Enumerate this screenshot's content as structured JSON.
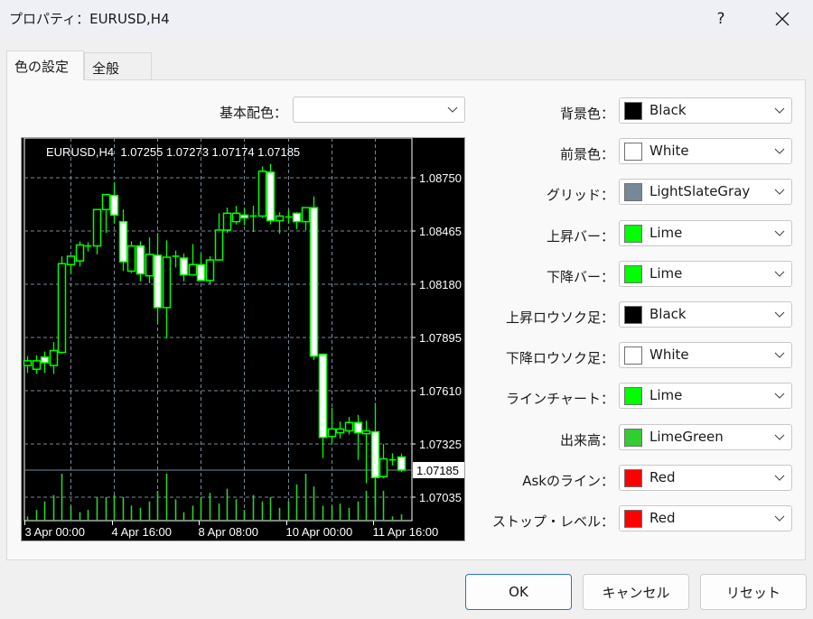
{
  "window": {
    "title": "プロパティ：EURUSD,H4",
    "help_label": "?",
    "close_label": "✕"
  },
  "tabs": [
    {
      "label": "色の設定",
      "active": true
    },
    {
      "label": "全般",
      "active": false
    }
  ],
  "base_scheme": {
    "label": "基本配色：",
    "value": ""
  },
  "color_settings": [
    {
      "label": "背景色：",
      "value": "Black",
      "color": "#000000"
    },
    {
      "label": "前景色：",
      "value": "White",
      "color": "#ffffff"
    },
    {
      "label": "グリッド：",
      "value": "LightSlateGray",
      "color": "#778899"
    },
    {
      "label": "上昇バー：",
      "value": "Lime",
      "color": "#00ff00"
    },
    {
      "label": "下降バー：",
      "value": "Lime",
      "color": "#00ff00"
    },
    {
      "label": "上昇ロウソク足：",
      "value": "Black",
      "color": "#000000"
    },
    {
      "label": "下降ロウソク足：",
      "value": "White",
      "color": "#ffffff"
    },
    {
      "label": "ラインチャート：",
      "value": "Lime",
      "color": "#00ff00"
    },
    {
      "label": "出来高：",
      "value": "LimeGreen",
      "color": "#32cd32"
    },
    {
      "label": "Askのライン：",
      "value": "Red",
      "color": "#ff0000"
    },
    {
      "label": "ストップ・レベル：",
      "value": "Red",
      "color": "#ff0000"
    }
  ],
  "buttons": {
    "ok": "OK",
    "cancel": "キャンセル",
    "reset": "リセット"
  },
  "chart_data": {
    "type": "candlestick",
    "title": "EURUSD,H4  1.07255 1.07273 1.07174 1.07185",
    "symbol": "EURUSD,H4",
    "ohlc_header": [
      "1.07255",
      "1.07273",
      "1.07174",
      "1.07185"
    ],
    "current_price": "1.07185",
    "ylim": [
      1.0695,
      1.0888
    ],
    "y_ticks": [
      "1.08750",
      "1.08465",
      "1.08180",
      "1.07895",
      "1.07610",
      "1.07325",
      "1.07035"
    ],
    "x_ticks": [
      "3 Apr 00:00",
      "4 Apr 16:00",
      "8 Apr 08:00",
      "10 Apr 00:00",
      "11 Apr 16:00"
    ],
    "x_tick_index": [
      0,
      10,
      20,
      30,
      40
    ],
    "grid": true,
    "colors": {
      "background": "#000000",
      "foreground": "#ffffff",
      "grid": "#778899",
      "bar_up": "#00ff00",
      "bar_down": "#00ff00",
      "candle_up": "#000000",
      "candle_down": "#ffffff",
      "volume": "#32cd32"
    },
    "candles": [
      {
        "o": 1.07745,
        "h": 1.07795,
        "l": 1.07705,
        "c": 1.0777
      },
      {
        "o": 1.07725,
        "h": 1.078,
        "l": 1.077,
        "c": 1.0777
      },
      {
        "o": 1.0779,
        "h": 1.0782,
        "l": 1.07705,
        "c": 1.0776
      },
      {
        "o": 1.07745,
        "h": 1.0787,
        "l": 1.077,
        "c": 1.07825
      },
      {
        "o": 1.07815,
        "h": 1.0833,
        "l": 1.0781,
        "c": 1.0829
      },
      {
        "o": 1.08285,
        "h": 1.0833,
        "l": 1.08235,
        "c": 1.0833
      },
      {
        "o": 1.08305,
        "h": 1.0841,
        "l": 1.08275,
        "c": 1.0839
      },
      {
        "o": 1.08385,
        "h": 1.08405,
        "l": 1.08355,
        "c": 1.08385
      },
      {
        "o": 1.08385,
        "h": 1.0858,
        "l": 1.0834,
        "c": 1.0858
      },
      {
        "o": 1.0858,
        "h": 1.0866,
        "l": 1.08455,
        "c": 1.0866
      },
      {
        "o": 1.08655,
        "h": 1.08725,
        "l": 1.08505,
        "c": 1.0855
      },
      {
        "o": 1.08515,
        "h": 1.0858,
        "l": 1.0825,
        "c": 1.083
      },
      {
        "o": 1.0825,
        "h": 1.0841,
        "l": 1.0824,
        "c": 1.08385
      },
      {
        "o": 1.08385,
        "h": 1.0841,
        "l": 1.08195,
        "c": 1.08235
      },
      {
        "o": 1.08225,
        "h": 1.0843,
        "l": 1.08185,
        "c": 1.0834
      },
      {
        "o": 1.08335,
        "h": 1.0845,
        "l": 1.0797,
        "c": 1.08055
      },
      {
        "o": 1.08055,
        "h": 1.08415,
        "l": 1.0789,
        "c": 1.08325
      },
      {
        "o": 1.08325,
        "h": 1.0836,
        "l": 1.0827,
        "c": 1.0833
      },
      {
        "o": 1.0832,
        "h": 1.08345,
        "l": 1.08195,
        "c": 1.0823
      },
      {
        "o": 1.0823,
        "h": 1.08395,
        "l": 1.0823,
        "c": 1.08285
      },
      {
        "o": 1.08285,
        "h": 1.08345,
        "l": 1.082,
        "c": 1.082
      },
      {
        "o": 1.082,
        "h": 1.0833,
        "l": 1.0818,
        "c": 1.0831
      },
      {
        "o": 1.0831,
        "h": 1.0856,
        "l": 1.08305,
        "c": 1.0847
      },
      {
        "o": 1.0847,
        "h": 1.0859,
        "l": 1.08455,
        "c": 1.0856
      },
      {
        "o": 1.08515,
        "h": 1.086,
        "l": 1.085,
        "c": 1.0856
      },
      {
        "o": 1.0855,
        "h": 1.08585,
        "l": 1.08495,
        "c": 1.08535
      },
      {
        "o": 1.08545,
        "h": 1.086,
        "l": 1.0846,
        "c": 1.08545
      },
      {
        "o": 1.08545,
        "h": 1.0881,
        "l": 1.08535,
        "c": 1.08785
      },
      {
        "o": 1.0878,
        "h": 1.08825,
        "l": 1.085,
        "c": 1.0852
      },
      {
        "o": 1.0852,
        "h": 1.08565,
        "l": 1.0845,
        "c": 1.08545
      },
      {
        "o": 1.0854,
        "h": 1.0858,
        "l": 1.08505,
        "c": 1.0854
      },
      {
        "o": 1.0856,
        "h": 1.08565,
        "l": 1.08475,
        "c": 1.08515
      },
      {
        "o": 1.08515,
        "h": 1.08585,
        "l": 1.0847,
        "c": 1.0859
      },
      {
        "o": 1.0859,
        "h": 1.0865,
        "l": 1.07775,
        "c": 1.07795
      },
      {
        "o": 1.07805,
        "h": 1.0781,
        "l": 1.0725,
        "c": 1.0736
      },
      {
        "o": 1.07365,
        "h": 1.0752,
        "l": 1.0733,
        "c": 1.07405
      },
      {
        "o": 1.07385,
        "h": 1.07445,
        "l": 1.07355,
        "c": 1.07405
      },
      {
        "o": 1.07395,
        "h": 1.0747,
        "l": 1.07375,
        "c": 1.0744
      },
      {
        "o": 1.0744,
        "h": 1.0748,
        "l": 1.0724,
        "c": 1.07385
      },
      {
        "o": 1.0738,
        "h": 1.0745,
        "l": 1.07115,
        "c": 1.07395
      },
      {
        "o": 1.0739,
        "h": 1.07545,
        "l": 1.06995,
        "c": 1.07145
      },
      {
        "o": 1.0715,
        "h": 1.07325,
        "l": 1.0714,
        "c": 1.07245
      },
      {
        "o": 1.0724,
        "h": 1.07275,
        "l": 1.0721,
        "c": 1.0724
      },
      {
        "o": 1.07255,
        "h": 1.07273,
        "l": 1.07174,
        "c": 1.07185
      }
    ],
    "volumes": [
      10,
      25,
      45,
      60,
      110,
      35,
      20,
      25,
      55,
      55,
      60,
      55,
      35,
      30,
      45,
      70,
      110,
      50,
      20,
      35,
      55,
      65,
      40,
      75,
      50,
      25,
      60,
      45,
      55,
      30,
      45,
      85,
      110,
      80,
      35,
      35,
      40,
      30,
      45,
      70,
      95,
      70,
      10,
      15
    ]
  }
}
